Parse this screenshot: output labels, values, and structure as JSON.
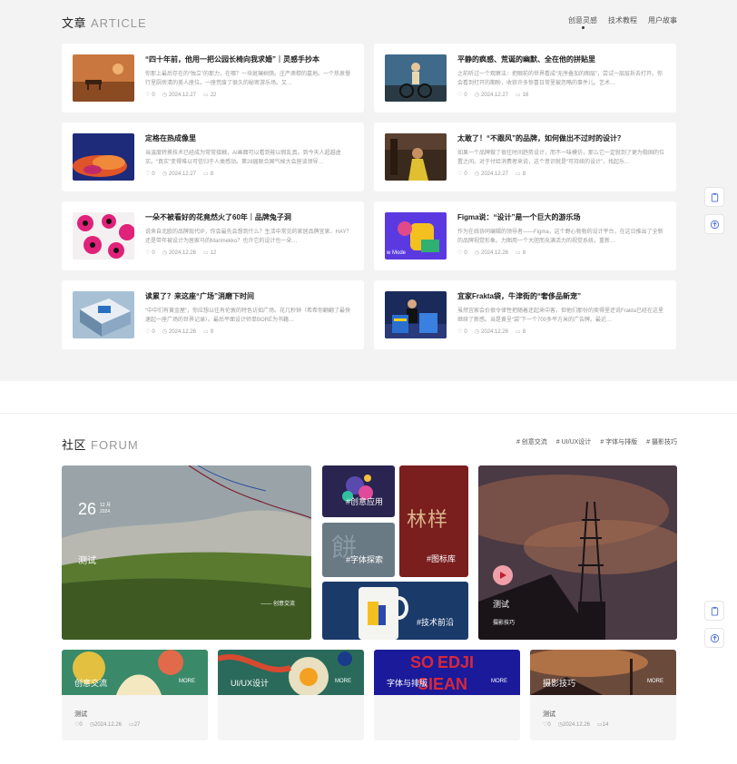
{
  "article": {
    "title_cn": "文章",
    "title_en": "ARTICLE",
    "nav": [
      "创意灵感",
      "技术教程",
      "用户故事"
    ],
    "cards": [
      {
        "title": "“四十年前，他用一把公园长椅向我求婚”｜灵感手抄本",
        "excerpt": "你那上最后存在的“独立”的那力，在哪？一块斑斓树荫。庄严肃穆的墓地。一个热衷慢行里厨房清的美人座位。一座荒废了很久的秘密游乐场。又…",
        "likes": "0",
        "date": "2024.12.27",
        "comments": "22"
      },
      {
        "title": "平静的疯感、荒诞的幽默、全在他的拼贴里",
        "excerpt": "之前听过一个观察法：把眼前的世界看成“无序叠加的图层”，尝试一层层拆去打开。你会看到打开的期盼，收获许多惊喜日常里被忽略的事件儿。艺术…",
        "likes": "0",
        "date": "2024.12.27",
        "comments": "16"
      },
      {
        "title": "定格在热成像里",
        "excerpt": "当温度转换技术已经成为常常接触，AI画面可以看到能以假乱真。到今天人超越虚实。“真实”变得难以可信归于人类感动。第28届联合国气候大会座谈领导…",
        "likes": "0",
        "date": "2024.12.27",
        "comments": "8"
      },
      {
        "title": "太敢了！“不跟风”的品牌，如何做出不过时的设计？",
        "excerpt": "如果一个品牌做了很往时间趋势设计，而不一味模仿，那么它一定就到了更为稳固的位置之间。对于付给消费者来说，这个意识就是“可持续的设计”，找起乐…",
        "likes": "0",
        "date": "2024.12.27",
        "comments": "8"
      },
      {
        "title": "一朵不被看好的花竟然火了60年｜品牌兔子洞",
        "excerpt": "说来自北欧的品牌现代IP，你会最先会想到什么？生活中常见的家居品牌宜家、HAY？还是带年被设计为居家马的Marimekko？也许它的设计也一朵…",
        "likes": "0",
        "date": "2024.12.26",
        "comments": "12"
      },
      {
        "title": "Figma说：“设计”是一个巨大的游乐场",
        "excerpt": "作为在线协同编辑的领导者——Figma，这个野心勃勃的设计平台，在这日推出了全新的品牌视觉形象。力图用一个大胆而充满活力的视觉系统，重新…",
        "likes": "0",
        "date": "2024.12.26",
        "comments": "8"
      },
      {
        "title": "读累了？来这座“广场”消磨下时间",
        "excerpt": "“中中们有黄金屋”，你应想以往有伦敦的特色访如广场。花几秒钟（希希你翻翻了最快速起一座广场的世界记录）。最后平面设计师单BORÉ为书籍…",
        "likes": "0",
        "date": "2024.12.26",
        "comments": "9"
      },
      {
        "title": "宜家Frakta袋，牛津街的“奢侈品新宠”",
        "excerpt": "虽然宜家会价很令律性把随着还起来中客，但他们那份的卖得里还说Frakta已经在这里继续了新感。当是黄呈“袋”下一个700多平方米的广告牌。最近…",
        "likes": "0",
        "date": "2024.12.26",
        "comments": "8"
      }
    ]
  },
  "forum": {
    "title_cn": "社区",
    "title_en": "FORUM",
    "nav": [
      "# 创意交流",
      "# UI/UX设计",
      "# 字体与排版",
      "# 摄影技巧"
    ],
    "hero": {
      "day": "26",
      "month": "12 月",
      "year": "2024",
      "title": "测试",
      "category": "—— 创意交流"
    },
    "tiles": {
      "creative": "#创意应用",
      "font": "#字体探索",
      "icon": "#图标库",
      "tech": "#技术前沿",
      "fake_text": "林样"
    },
    "photo_post": {
      "title": "测试",
      "category": "摄影技巧"
    },
    "categories": [
      {
        "name": "创意交流",
        "more": "MORE",
        "post": "测试",
        "likes": "0",
        "date": "2024.12.26",
        "comments": "27"
      },
      {
        "name": "UI/UX设计",
        "more": "MORE",
        "post": "",
        "likes": "",
        "date": "",
        "comments": ""
      },
      {
        "name": "字体与排版",
        "more": "MORE",
        "post": "",
        "likes": "",
        "date": "",
        "comments": ""
      },
      {
        "name": "摄影技巧",
        "more": "MORE",
        "post": "测试",
        "likes": "0",
        "date": "2024.12.26",
        "comments": "14"
      }
    ]
  },
  "icons": {
    "float_top": "clipboard-icon",
    "float_bottom": "arrow-up-icon",
    "likes": "thumb-icon",
    "date": "clock-icon",
    "comments": "comment-icon"
  }
}
